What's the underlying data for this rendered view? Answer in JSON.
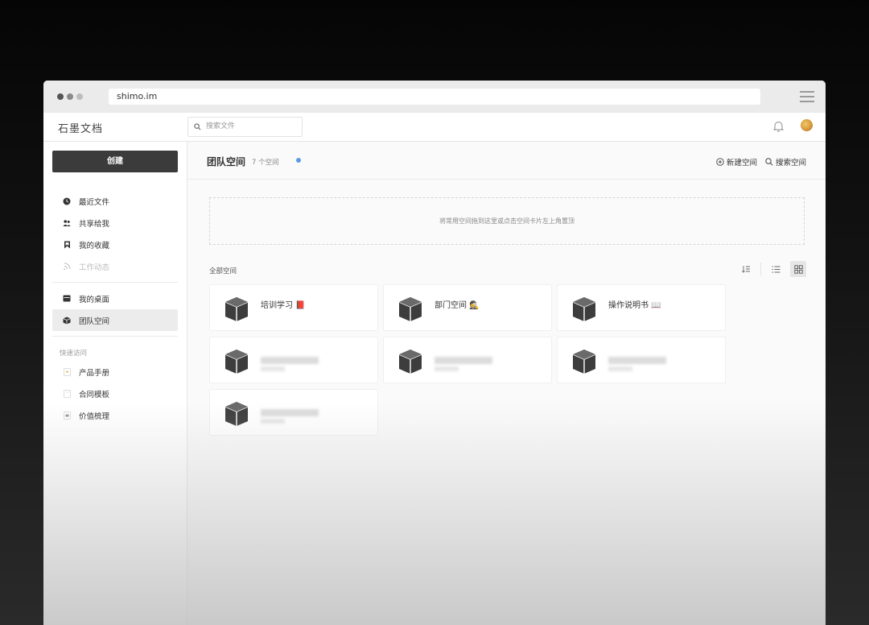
{
  "browser": {
    "url": "shimo.im"
  },
  "app": {
    "brand": "石墨文档",
    "search_placeholder": "搜索文件"
  },
  "sidebar": {
    "create_label": "创建",
    "items": [
      {
        "label": "最近文件",
        "icon": "clock-icon"
      },
      {
        "label": "共享给我",
        "icon": "people-icon"
      },
      {
        "label": "我的收藏",
        "icon": "bookmark-icon"
      },
      {
        "label": "工作动态",
        "icon": "feed-icon",
        "muted": true
      }
    ],
    "items2": [
      {
        "label": "我的桌面",
        "icon": "desktop-icon"
      },
      {
        "label": "团队空间",
        "icon": "cube-icon",
        "active": true
      }
    ],
    "quick_label": "快速访问",
    "quick": [
      {
        "label": "产品手册"
      },
      {
        "label": "合同模板"
      },
      {
        "label": "价值梳理"
      }
    ]
  },
  "header": {
    "title": "团队空间",
    "count": "7 个空间",
    "new_space": "新建空间",
    "search_space": "搜索空间"
  },
  "drop_zone": "将常用空间拖到这里或点击空间卡片左上角置顶",
  "all_spaces_label": "全部空间",
  "spaces": [
    {
      "name": "培训学习",
      "emoji": "📕"
    },
    {
      "name": "部门空间",
      "emoji": "🕵"
    },
    {
      "name": "操作说明书",
      "emoji": "📖"
    }
  ],
  "colors": {
    "accent_dot": "#5b9be6",
    "create_button": "#3b3b3b"
  }
}
